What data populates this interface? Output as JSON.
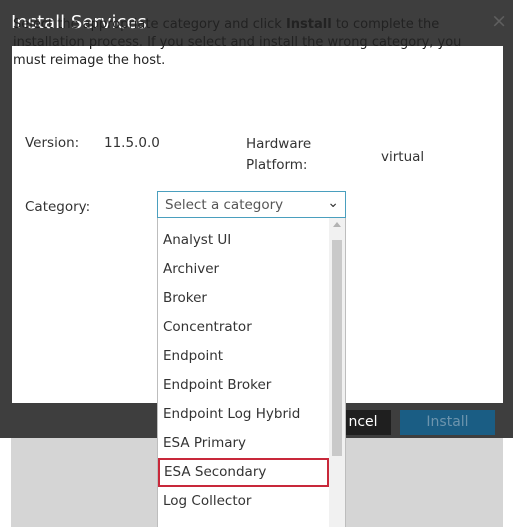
{
  "dialog": {
    "title": "Install Services",
    "close_glyph": "×",
    "description_before": "Select the appropriate category and click ",
    "description_bold": "Install",
    "description_after": " to complete the installation process. If you select and install the wrong category, you must reimage the host.",
    "version_label": "Version:",
    "version_value": "11.5.0.0",
    "hardware_label_1": "Hardware",
    "hardware_label_2": "Platform:",
    "hardware_value": "virtual",
    "category_label": "Category:",
    "select_placeholder": "Select a category",
    "select_chevron": "⌄",
    "options": [
      "Analyst UI",
      "Archiver",
      "Broker",
      "Concentrator",
      "Endpoint",
      "Endpoint Broker",
      "Endpoint Log Hybrid",
      "ESA Primary",
      "ESA Secondary",
      "Log Collector"
    ],
    "highlighted_option_index": 8
  },
  "footer": {
    "cancel_label": "ncel",
    "install_label": "Install"
  },
  "colors": {
    "titlebar": "#3e3e3e",
    "highlight_border": "#c8283a",
    "select_border": "#4a9fbe",
    "install_button": "#1a5d84"
  }
}
